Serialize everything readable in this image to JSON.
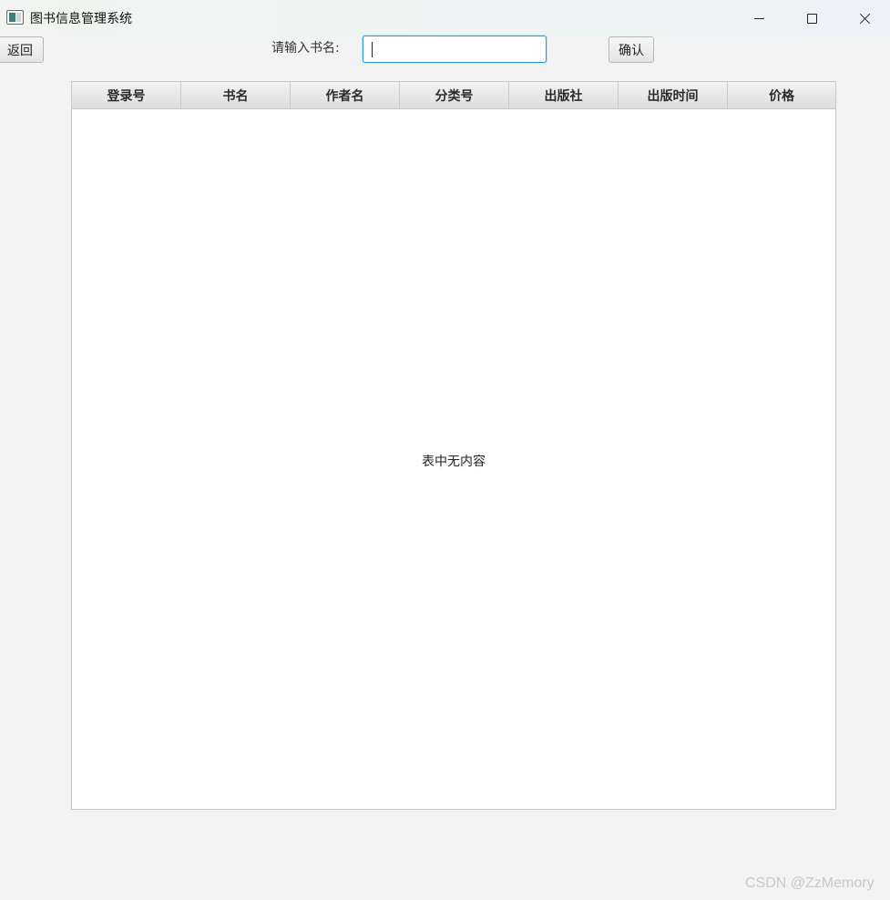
{
  "window": {
    "title": "图书信息管理系统",
    "icons": {
      "app": "app-window-icon",
      "minimize": "minimize-icon",
      "maximize": "maximize-icon",
      "close": "close-icon"
    }
  },
  "toolbar": {
    "back_label": "返回",
    "search_label": "请输入书名:",
    "search_value": "",
    "search_placeholder": "",
    "confirm_label": "确认"
  },
  "table": {
    "columns": [
      "登录号",
      "书名",
      "作者名",
      "分类号",
      "出版社",
      "出版时间",
      "价格"
    ],
    "rows": [],
    "empty_message": "表中无内容"
  },
  "watermark": "CSDN @ZzMemory",
  "colors": {
    "input_focus": "#2a9fd6",
    "background": "#f3f3f3",
    "table_bg": "#ffffff"
  }
}
